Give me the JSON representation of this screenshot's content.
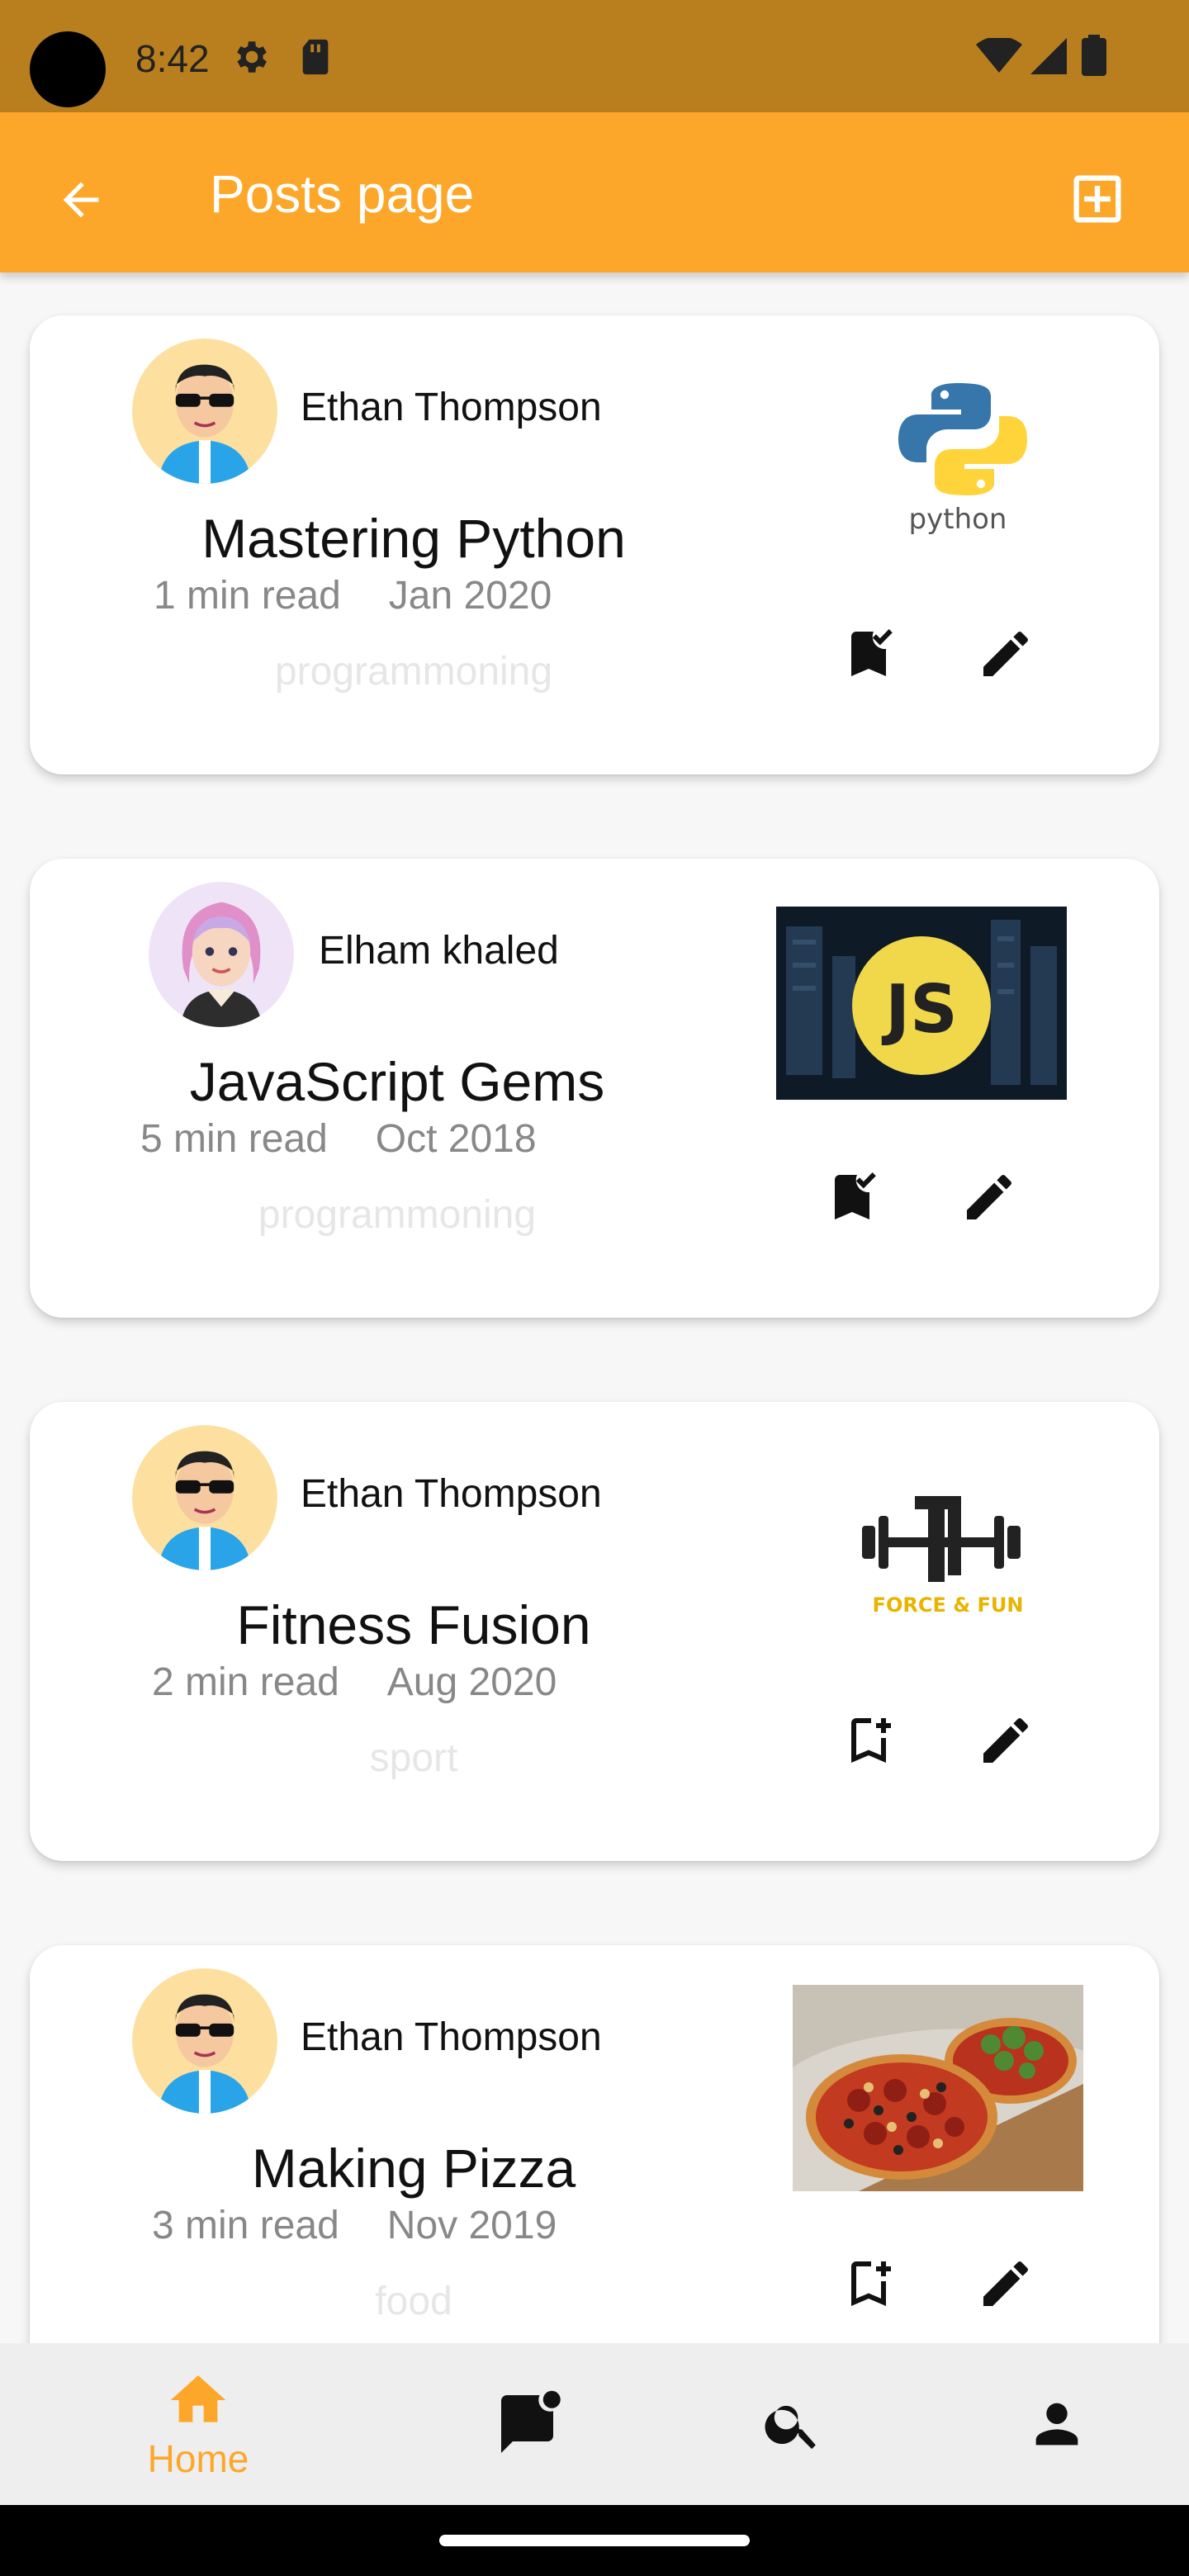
{
  "status_bar": {
    "time": "8:42"
  },
  "app_bar": {
    "title": "Posts page"
  },
  "posts": [
    {
      "author": "Ethan Thompson",
      "title": "Mastering Python",
      "read_time": "1 min read",
      "date": "Jan 2020",
      "category": "programmoning",
      "image": "python",
      "image_text": "python",
      "bookmarked": true
    },
    {
      "author": "Elham khaled",
      "title": "JavaScript Gems",
      "read_time": "5 min read",
      "date": "Oct 2018",
      "category": "programmoning",
      "image": "javascript",
      "image_text": "JS",
      "bookmarked": true
    },
    {
      "author": "Ethan Thompson",
      "title": "Fitness Fusion",
      "read_time": "2 min read",
      "date": "Aug 2020",
      "category": "sport",
      "image": "force-and-fun",
      "image_text": "FORCE & FUN",
      "bookmarked": false
    },
    {
      "author": "Ethan Thompson",
      "title": "Making Pizza",
      "read_time": "3 min read",
      "date": "Nov 2019",
      "category": "food",
      "image": "pizza",
      "bookmarked": false
    }
  ],
  "bottom_nav": {
    "items": [
      {
        "label": "Home",
        "icon": "home-icon",
        "active": true
      },
      {
        "label": "",
        "icon": "chat-notification-icon",
        "active": false
      },
      {
        "label": "",
        "icon": "search-icon",
        "active": false
      },
      {
        "label": "",
        "icon": "person-icon",
        "active": false
      }
    ]
  },
  "colors": {
    "accent": "#fda72a",
    "status_bar": "#b97f1f",
    "inactive_text": "#888888"
  }
}
